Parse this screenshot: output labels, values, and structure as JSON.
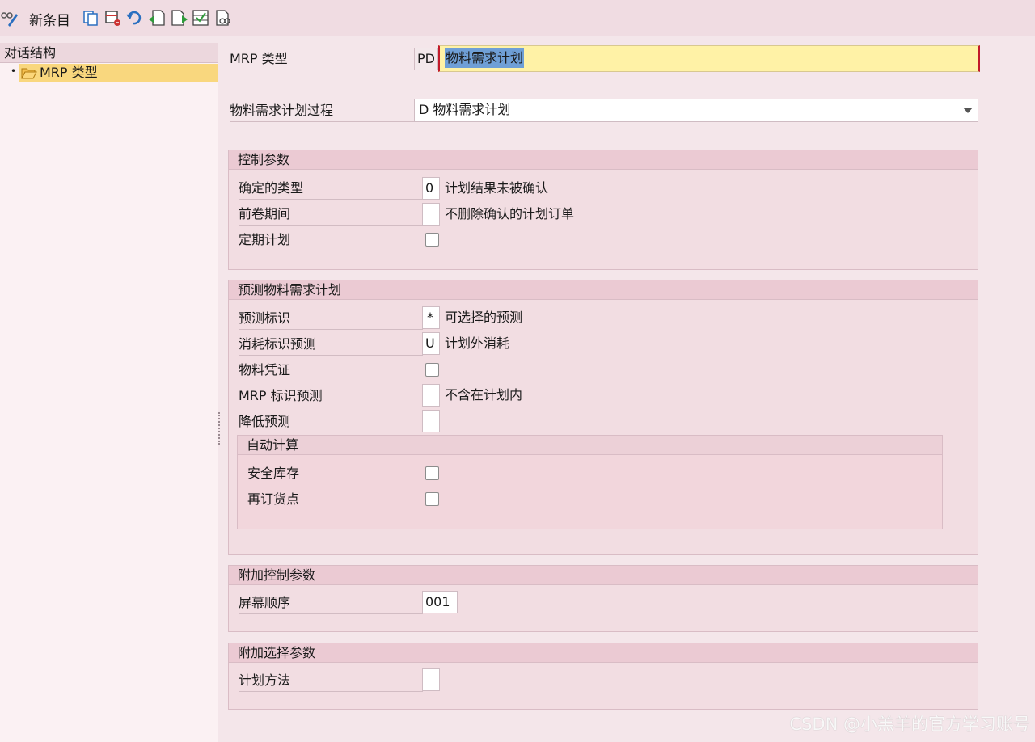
{
  "toolbar": {
    "new_entries_label": "新条目"
  },
  "sidebar": {
    "header": "对话结构",
    "tree_item": "MRP 类型"
  },
  "main": {
    "mrp_type": {
      "label": "MRP 类型",
      "code": "PD",
      "value": "物料需求计划"
    },
    "mrp_procedure": {
      "label": "物料需求计划过程",
      "value": "D 物料需求计划"
    },
    "control_params": {
      "title": "控制参数",
      "firming_type": {
        "label": "确定的类型",
        "value": "0",
        "desc": "计划结果未被确认"
      },
      "roll_forward": {
        "label": "前卷期间",
        "value": "",
        "desc": "不删除确认的计划订单"
      },
      "periodic_planning": {
        "label": "定期计划",
        "checked": false
      }
    },
    "forecast_mrp": {
      "title": "预测物料需求计划",
      "forecast_ind": {
        "label": "预测标识",
        "value": "*",
        "desc": "可选择的预测"
      },
      "consumption_ind": {
        "label": "消耗标识预测",
        "value": "U",
        "desc": "计划外消耗"
      },
      "material_doc": {
        "label": "物料凭证",
        "checked": false
      },
      "mrp_ind_forecast": {
        "label": "MRP 标识预测",
        "value": "",
        "desc": "不含在计划内"
      },
      "reduce_forecast": {
        "label": "降低预测",
        "value": ""
      },
      "auto_calc": {
        "title": "自动计算",
        "safety_stock": {
          "label": "安全库存",
          "checked": false
        },
        "reorder_point": {
          "label": "再订货点",
          "checked": false
        }
      }
    },
    "additional_control": {
      "title": "附加控制参数",
      "screen_sequence": {
        "label": "屏幕顺序",
        "value": "001"
      }
    },
    "additional_select": {
      "title": "附加选择参数",
      "planning_method": {
        "label": "计划方法",
        "value": ""
      }
    }
  },
  "watermark": "CSDN @小羔羊的官方学习账号"
}
